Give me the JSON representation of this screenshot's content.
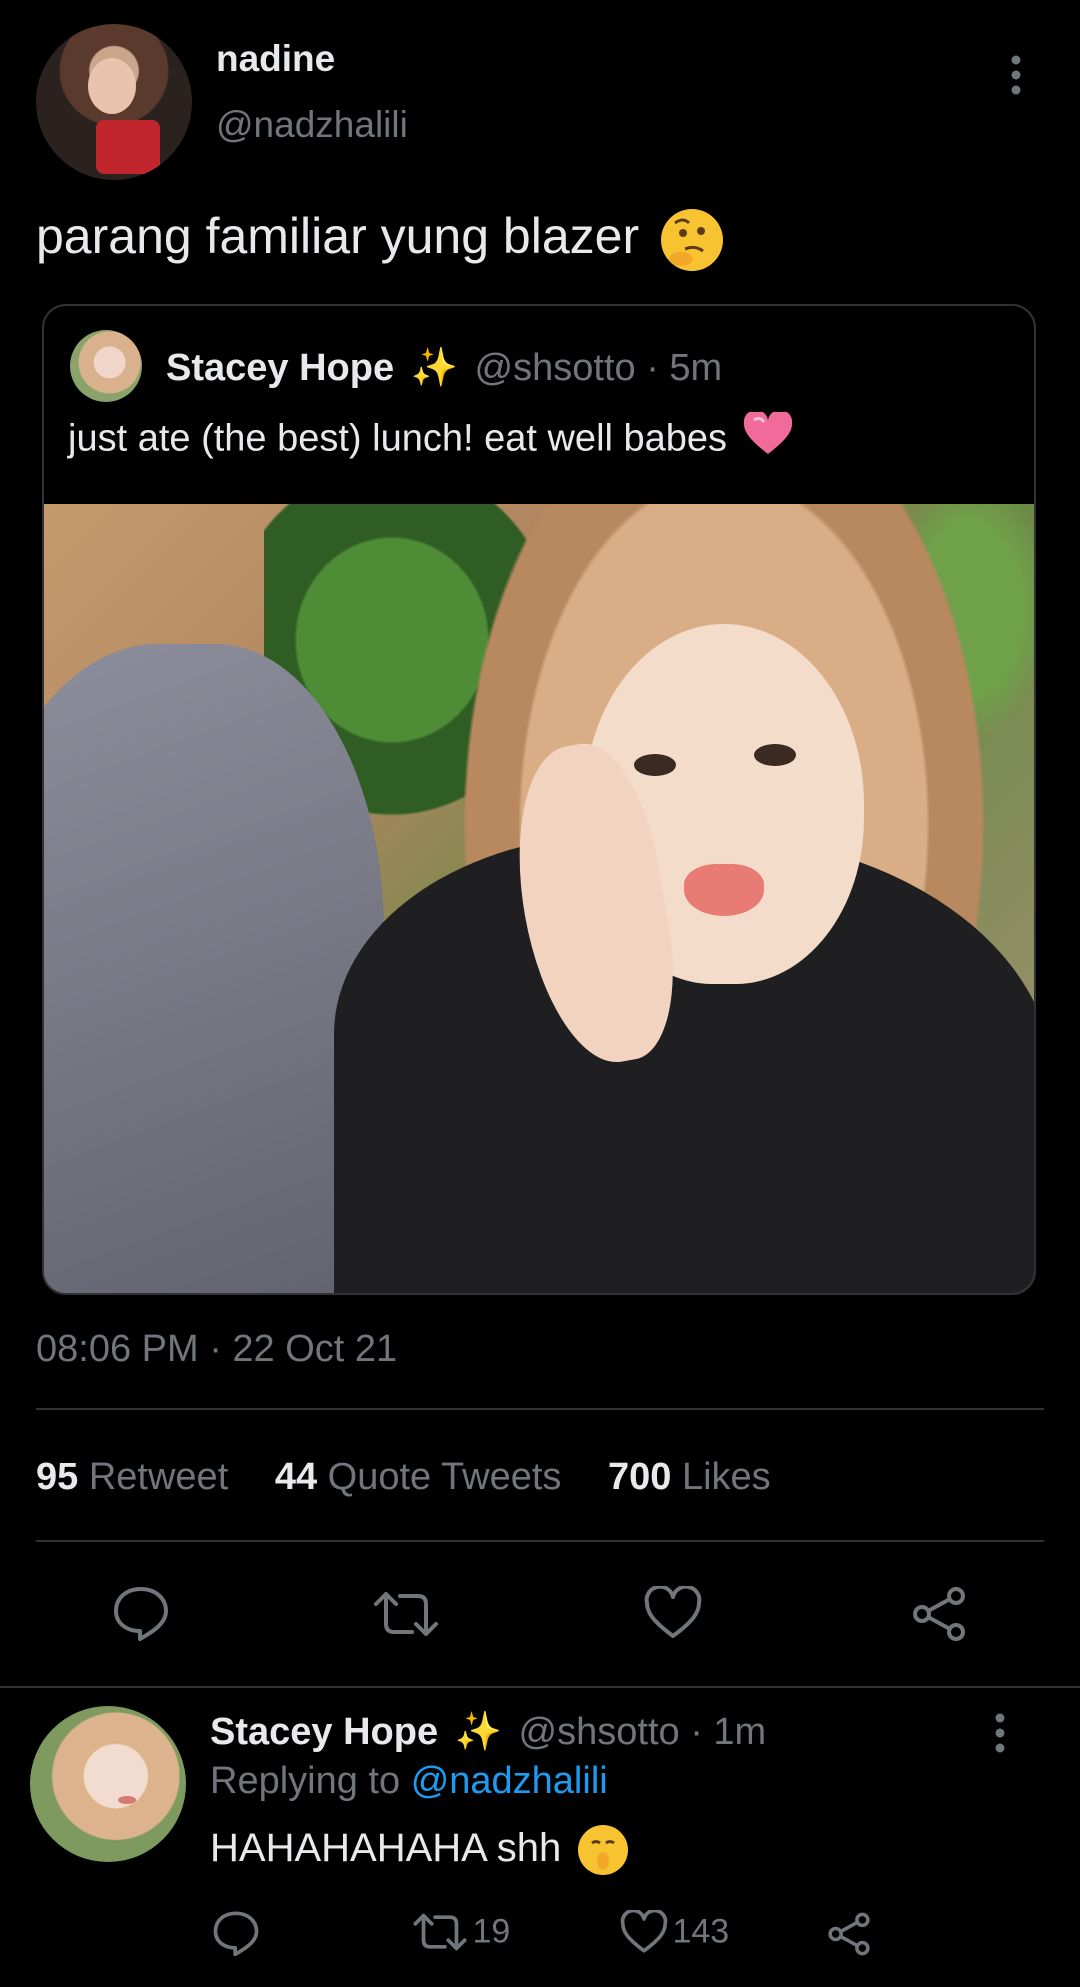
{
  "tweet": {
    "author_name": "nadine",
    "author_handle": "@nadzhalili",
    "text": "parang familiar yung blazer",
    "timestamp": "08:06 PM · 22 Oct 21",
    "stats": {
      "retweets_count": "95",
      "retweets_label": "Retweet",
      "quotes_count": "44",
      "quotes_label": "Quote Tweets",
      "likes_count": "700",
      "likes_label": "Likes"
    }
  },
  "quoted": {
    "author_name": "Stacey Hope",
    "author_handle": "@shsotto",
    "time": "· 5m",
    "text": "just ate (the best) lunch! eat well babes"
  },
  "reply": {
    "author_name": "Stacey Hope",
    "author_handle": "@shsotto",
    "time": "· 1m",
    "replying_prefix": "Replying to",
    "replying_to": "@nadzhalili",
    "text": "HAHAHAHAHA shh",
    "retweets": "19",
    "likes": "143"
  },
  "icons": [
    "more-vertical-icon",
    "thinking-emoji-icon",
    "sparkles-icon",
    "pink-heart-icon",
    "reply-icon",
    "retweet-icon",
    "like-icon",
    "share-icon",
    "shushing-emoji-icon"
  ],
  "colors": {
    "background": "#000000",
    "text": "#e7e9ea",
    "muted": "#71767b",
    "link": "#1d9bf0",
    "border": "#2f3336"
  }
}
